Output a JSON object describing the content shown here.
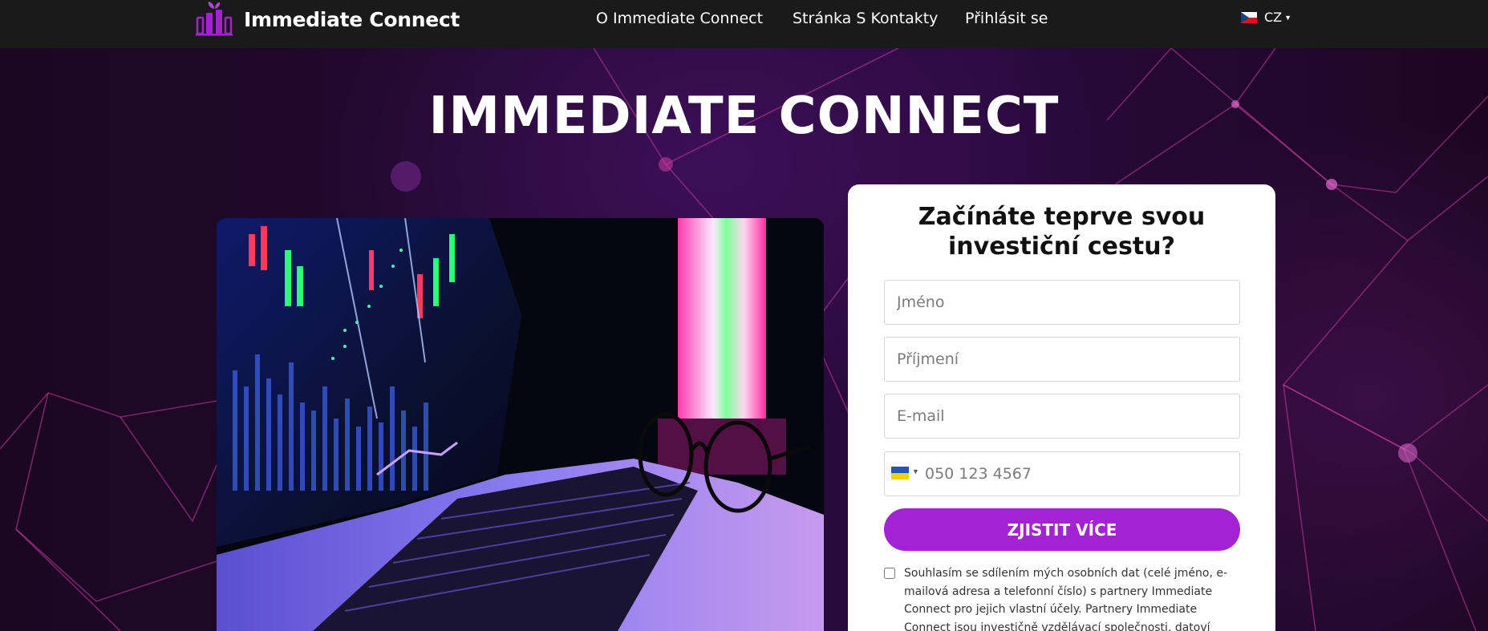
{
  "header": {
    "brand_name": "Immediate Connect",
    "logo_icon": "chart-bars-leaf-icon",
    "nav": [
      {
        "label": "O Immediate Connect"
      },
      {
        "label": "Stránka S Kontakty"
      },
      {
        "label": "Přihlásit se"
      }
    ],
    "language": {
      "code": "CZ",
      "flag": "czech-flag-icon"
    }
  },
  "hero": {
    "title": "IMMEDIATE CONNECT"
  },
  "form": {
    "title_line1": "Začínáte teprve svou",
    "title_line2": "investiční cestu?",
    "first_name": {
      "placeholder": "Jméno",
      "value": ""
    },
    "last_name": {
      "placeholder": "Příjmení",
      "value": ""
    },
    "email": {
      "placeholder": "E-mail",
      "value": ""
    },
    "phone": {
      "placeholder": "050 123 4567",
      "value": "",
      "country_flag": "ukraine-flag-icon"
    },
    "submit_label": "ZJISTIT VÍCE",
    "consent_text": "Souhlasím se sdílením mých osobních dat (celé jméno, e-mailová adresa a telefonní číslo) s partnery Immediate Connect pro jejich vlastní účely. Partnery Immediate Connect jsou investičně vzdělávací společnosti, datoví"
  },
  "colors": {
    "header_bg": "#1a1a1a",
    "accent": "#a323d2",
    "hero_bg": "#220833",
    "card_bg": "#ffffff"
  }
}
